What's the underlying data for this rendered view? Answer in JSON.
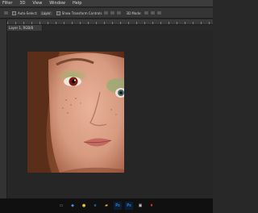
{
  "menubar": {
    "items": [
      "Filter",
      "3D",
      "View",
      "Window",
      "Help"
    ]
  },
  "options": {
    "sample_label": "Auto-Select:",
    "layer_value": "Layer",
    "show_transform_label": "Show Transform Controls",
    "mode_label": "3D Mode:"
  },
  "document": {
    "tab_title": "Layer 1, RGB/8"
  },
  "photo": {
    "subject": "portrait"
  },
  "taskbar": {
    "icons": [
      {
        "name": "task-view-icon",
        "glyph": "▭",
        "color": "#9a9a9a",
        "bg": "transparent"
      },
      {
        "name": "visual-studio-icon",
        "glyph": "◆",
        "color": "#4f8edc",
        "bg": "transparent"
      },
      {
        "name": "chrome-icon",
        "glyph": "●",
        "color": "#e8c33a",
        "bg": "transparent"
      },
      {
        "name": "edge-icon",
        "glyph": "e",
        "color": "#3a8ee6",
        "bg": "transparent"
      },
      {
        "name": "file-explorer-icon",
        "glyph": "▰",
        "color": "#e0b14c",
        "bg": "transparent"
      },
      {
        "name": "photoshop-icon",
        "glyph": "Ps",
        "color": "#31a8ff",
        "bg": "#0b1e33"
      },
      {
        "name": "photoshop-icon-2",
        "glyph": "Ps",
        "color": "#31a8ff",
        "bg": "#0b1e33"
      },
      {
        "name": "gallery-icon",
        "glyph": "▣",
        "color": "#c9c9c9",
        "bg": "transparent"
      },
      {
        "name": "app-red-icon",
        "glyph": "♦",
        "color": "#e03030",
        "bg": "transparent"
      }
    ]
  }
}
